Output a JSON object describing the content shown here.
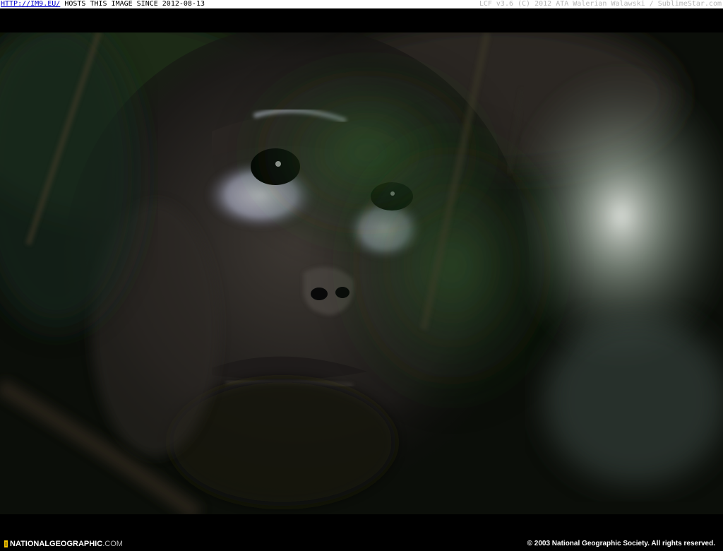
{
  "topbar": {
    "link_text": "HTTP://IM9.EU/",
    "hosts_text": " HOSTS THIS IMAGE SINCE 2012-08-13",
    "credit_text": "LCF v3.6 (C) 2012 ATA Walerian Walawski / SublimeStar.com"
  },
  "photo": {
    "subject": "gorilla face behind foliage",
    "palette": {
      "background": "#0a0d08",
      "foliage": "#1f3a1c",
      "skin": "#3b3530",
      "highlight": "#d8dde6",
      "bokeh": "#9fb6a8"
    }
  },
  "footer": {
    "logo_text": "NATIONALGEOGRAPHIC",
    "logo_suffix": ".COM",
    "copyright": "© 2003 National Geographic Society. All rights reserved.",
    "logo_color": "#f5c400"
  }
}
